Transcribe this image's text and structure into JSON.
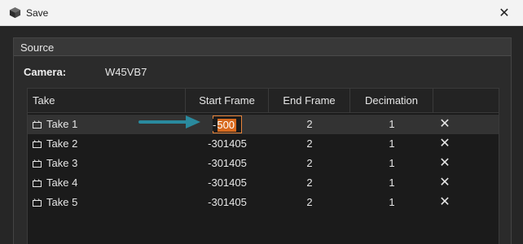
{
  "window": {
    "title": "Save",
    "close_glyph": "✕"
  },
  "source": {
    "label": "Source",
    "camera_label": "Camera:",
    "camera_value": "W45VB7"
  },
  "table": {
    "headers": {
      "take": "Take",
      "start": "Start Frame",
      "end": "End Frame",
      "decimation": "Decimation"
    },
    "rows": [
      {
        "take": "Take 1",
        "start": "-500",
        "end": "2",
        "decimation": "1",
        "delete": "✕"
      },
      {
        "take": "Take 2",
        "start": "-301405",
        "end": "2",
        "decimation": "1",
        "delete": "✕"
      },
      {
        "take": "Take 3",
        "start": "-301405",
        "end": "2",
        "decimation": "1",
        "delete": "✕"
      },
      {
        "take": "Take 4",
        "start": "-301405",
        "end": "2",
        "decimation": "1",
        "delete": "✕"
      },
      {
        "take": "Take 5",
        "start": "-301405",
        "end": "2",
        "decimation": "1",
        "delete": "✕"
      }
    ]
  },
  "editing": {
    "prefix": "-",
    "selected_text": "500"
  },
  "colors": {
    "highlight": "#d86a1e",
    "arrow": "#2a8a9e",
    "background": "#1e1e1e"
  },
  "icons": {
    "app": "cube-icon",
    "take": "clapperboard-icon",
    "delete": "close-icon"
  }
}
